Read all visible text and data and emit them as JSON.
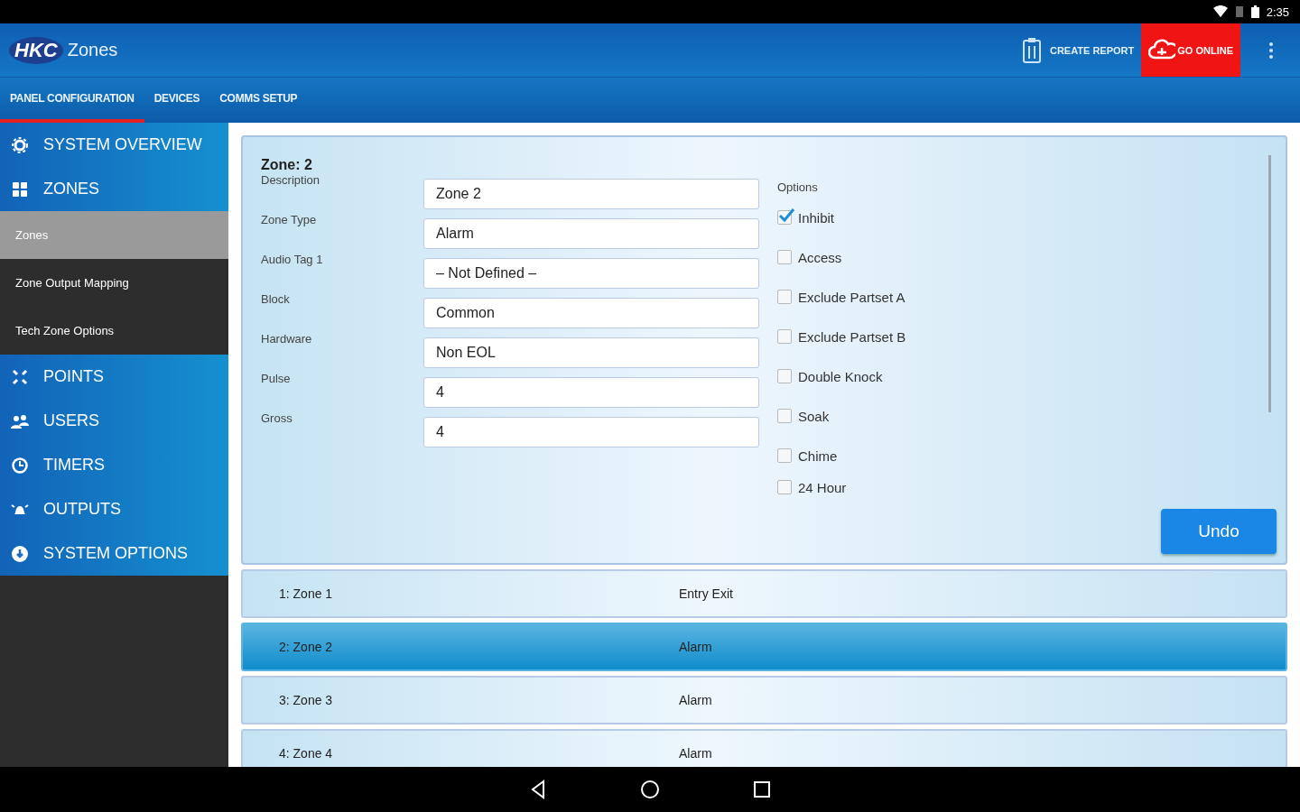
{
  "status_bar": {
    "time": "2:35"
  },
  "app_bar": {
    "logo": "HKC",
    "title": "Zones",
    "actions": [
      {
        "label": "CREATE REPORT",
        "kind": "report",
        "highlighted": false
      },
      {
        "label": "GO ONLINE",
        "kind": "online",
        "highlighted": true
      }
    ]
  },
  "tabs": [
    {
      "label": "PANEL CONFIGURATION",
      "selected": true
    },
    {
      "label": "DEVICES",
      "selected": false
    },
    {
      "label": "COMMS SETUP",
      "selected": false
    }
  ],
  "sidebar": {
    "items": [
      {
        "label": "SYSTEM OVERVIEW"
      },
      {
        "label": "ZONES",
        "children": [
          {
            "label": "Zones",
            "selected": true
          },
          {
            "label": "Zone Output Mapping",
            "selected": false
          },
          {
            "label": "Tech Zone Options",
            "selected": false
          }
        ]
      },
      {
        "label": "POINTS"
      },
      {
        "label": "USERS"
      },
      {
        "label": "TIMERS"
      },
      {
        "label": "OUTPUTS"
      },
      {
        "label": "SYSTEM OPTIONS"
      }
    ]
  },
  "zone_form": {
    "title": "Zone: 2",
    "fields": [
      {
        "label": "Description",
        "value": "Zone 2"
      },
      {
        "label": "Zone Type",
        "value": "Alarm"
      },
      {
        "label": "Audio Tag 1",
        "value": "– Not Defined –"
      },
      {
        "label": "Block",
        "value": "Common"
      },
      {
        "label": "Hardware",
        "value": "Non EOL"
      },
      {
        "label": "Pulse",
        "value": "4"
      },
      {
        "label": "Gross",
        "value": "4"
      }
    ],
    "options_label": "Options",
    "options": [
      {
        "label": "Inhibit",
        "checked": true
      },
      {
        "label": "Access",
        "checked": false
      },
      {
        "label": "Exclude Partset A",
        "checked": false
      },
      {
        "label": "Exclude Partset B",
        "checked": false
      },
      {
        "label": "Double Knock",
        "checked": false
      },
      {
        "label": "Soak",
        "checked": false
      },
      {
        "label": "Chime",
        "checked": false
      },
      {
        "label": "24 Hour",
        "checked": false
      }
    ],
    "undo_button": "Undo"
  },
  "zone_list": [
    {
      "name": "1: Zone 1",
      "type": "Entry Exit",
      "selected": false
    },
    {
      "name": "2: Zone 2",
      "type": "Alarm",
      "selected": true
    },
    {
      "name": "3: Zone 3",
      "type": "Alarm",
      "selected": false
    },
    {
      "name": "4: Zone 4",
      "type": "Alarm",
      "selected": false
    }
  ]
}
